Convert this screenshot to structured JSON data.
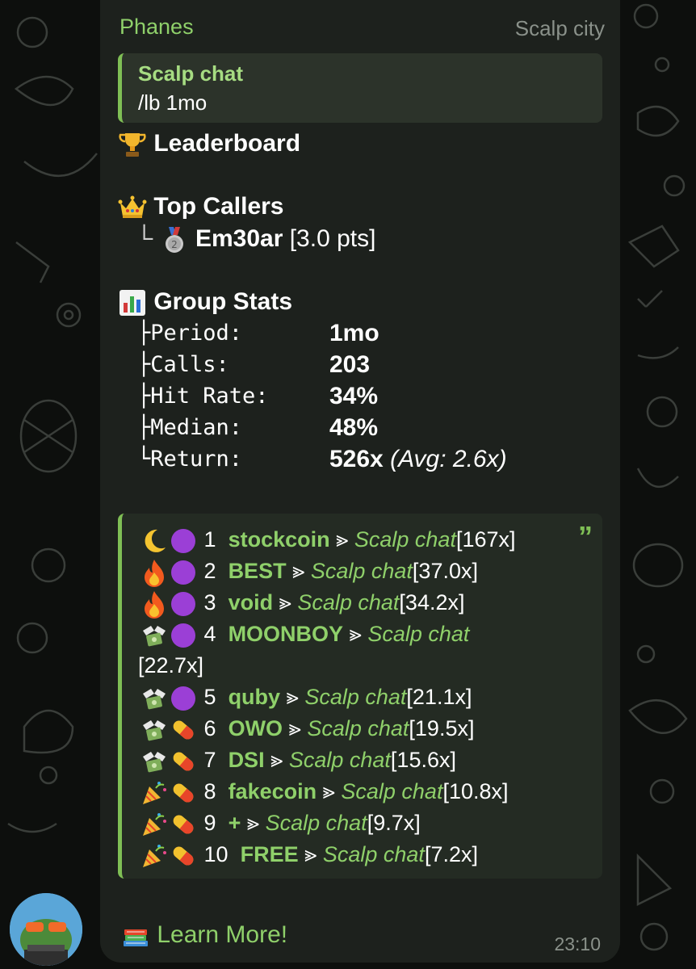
{
  "message": {
    "sender": "Phanes",
    "channel": "Scalp city",
    "reply": {
      "title": "Scalp chat",
      "text": "/lb 1mo"
    },
    "leaderboard_title": "Leaderboard",
    "top_callers_title": "Top Callers",
    "top_callers": [
      {
        "branch": "└",
        "name": "Em30ar",
        "points": "[3.0 pts]"
      }
    ],
    "group_stats_title": "Group Stats",
    "stats": [
      {
        "branch": "├",
        "label": "Period:",
        "value": "1mo"
      },
      {
        "branch": "├",
        "label": "Calls:",
        "value": "203"
      },
      {
        "branch": "├",
        "label": "Hit Rate:",
        "value": "34%"
      },
      {
        "branch": "├",
        "label": "Median:",
        "value": "48%"
      },
      {
        "branch": "└",
        "label": "Return:",
        "value": "526x",
        "extra": "(Avg: 2.6x)"
      }
    ],
    "calls": [
      {
        "rank": "1",
        "name": "stockcoin",
        "sep": "⪢",
        "group": "Scalp chat",
        "mult": "[167x]"
      },
      {
        "rank": "2",
        "name": "BEST",
        "sep": "⪢",
        "group": "Scalp chat",
        "mult": "[37.0x]"
      },
      {
        "rank": "3",
        "name": "void",
        "sep": "⪢",
        "group": "Scalp chat",
        "mult": "[34.2x]"
      },
      {
        "rank": "4",
        "name": "MOONBOY",
        "sep": "⪢",
        "group": "Scalp chat",
        "mult": "[22.7x]"
      },
      {
        "rank": "5",
        "name": "quby",
        "sep": "⪢",
        "group": "Scalp chat",
        "mult": "[21.1x]"
      },
      {
        "rank": "6",
        "name": "OWO",
        "sep": "⪢",
        "group": "Scalp chat",
        "mult": "[19.5x]"
      },
      {
        "rank": "7",
        "name": "DSI",
        "sep": "⪢",
        "group": "Scalp chat",
        "mult": "[15.6x]"
      },
      {
        "rank": "8",
        "name": "fakecoin",
        "sep": "⪢",
        "group": "Scalp chat",
        "mult": "[10.8x]"
      },
      {
        "rank": "9",
        "name": "+",
        "sep": "⪢",
        "group": "Scalp chat",
        "mult": "[9.7x]"
      },
      {
        "rank": "10",
        "name": "FREE",
        "sep": "⪢",
        "group": "Scalp chat",
        "mult": "[7.2x]"
      }
    ],
    "learn_more": "Learn More!",
    "time": "23:10"
  }
}
